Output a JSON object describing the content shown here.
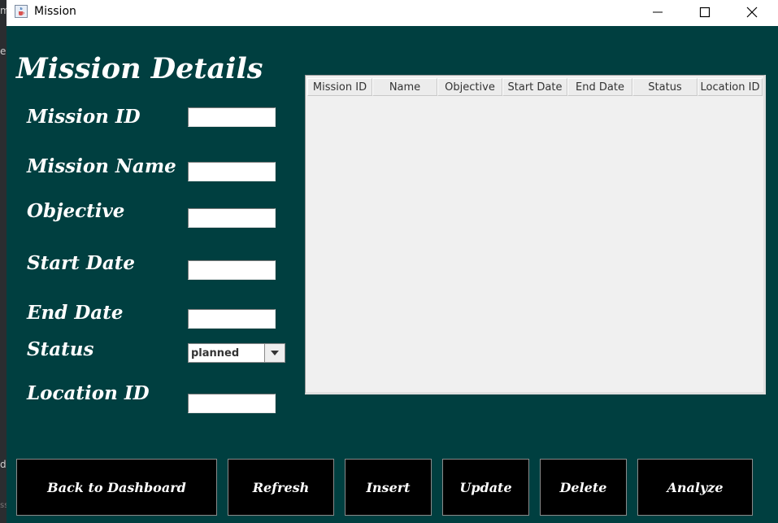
{
  "window": {
    "title": "Mission"
  },
  "background_fragments": [
    "m",
    "e",
    "d",
    "ss"
  ],
  "form": {
    "heading": "Mission Details",
    "fields": [
      {
        "label": "Mission ID",
        "value": ""
      },
      {
        "label": "Mission Name",
        "value": ""
      },
      {
        "label": "Objective",
        "value": ""
      },
      {
        "label": "Start Date",
        "value": ""
      },
      {
        "label": "End Date",
        "value": ""
      },
      {
        "label": "Status",
        "value": "planned"
      },
      {
        "label": "Location ID",
        "value": ""
      }
    ]
  },
  "table": {
    "columns": [
      "Mission ID",
      "Name",
      "Objective",
      "Start Date",
      "End Date",
      "Status",
      "Location ID"
    ],
    "rows": []
  },
  "buttons": {
    "back": "Back to Dashboard",
    "refresh": "Refresh",
    "insert": "Insert",
    "update": "Update",
    "delete": "Delete",
    "analyze": "Analyze"
  },
  "colors": {
    "window_background": "#003f40",
    "button_background": "#000000",
    "label_text": "#ffffff"
  },
  "icons": {
    "app": "java-cup-icon",
    "minimize": "minimize-icon",
    "maximize": "maximize-icon",
    "close": "close-icon",
    "dropdown": "chevron-down-icon"
  }
}
